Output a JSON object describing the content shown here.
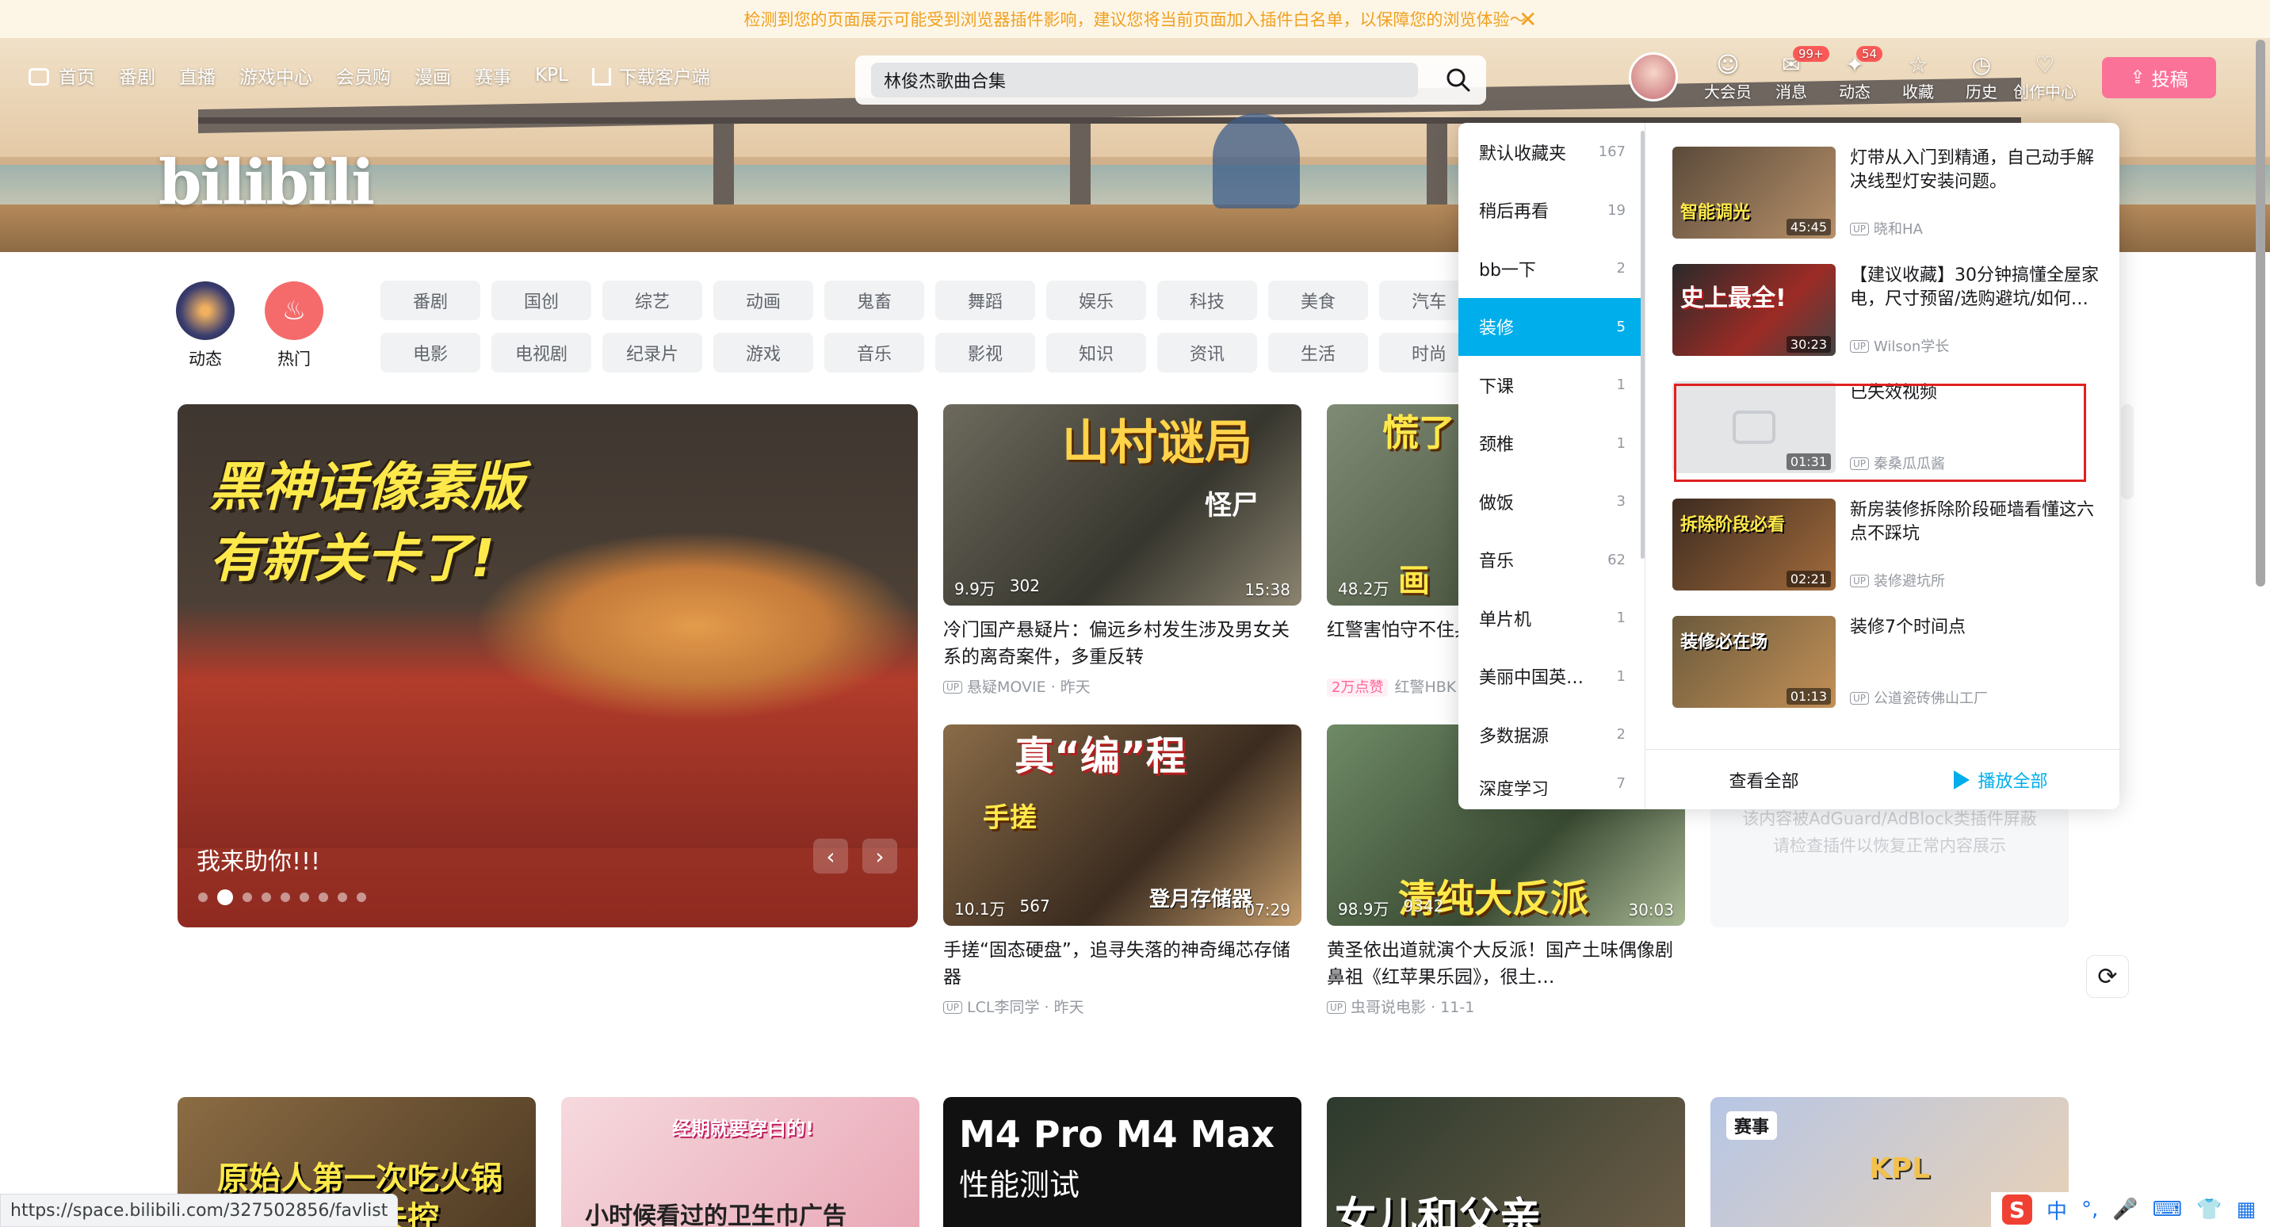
{
  "warning_bar": {
    "text": "检测到您的页面展示可能受到浏览器插件影响，建议您将当前页面加入插件白名单，以保障您的浏览体验～",
    "close_glyph": "✕"
  },
  "nav": {
    "items": [
      "首页",
      "番剧",
      "直播",
      "游戏中心",
      "会员购",
      "漫画",
      "赛事",
      "KPL",
      "下载客户端"
    ]
  },
  "logo_text": "bilibili",
  "search": {
    "value": "林俊杰歌曲合集",
    "icon": "search-icon"
  },
  "header_icons": [
    {
      "label": "大会员",
      "glyph": "☺",
      "badge": ""
    },
    {
      "label": "消息",
      "glyph": "✉",
      "badge": "99+"
    },
    {
      "label": "动态",
      "glyph": "✦",
      "badge": "54"
    },
    {
      "label": "收藏",
      "glyph": "☆",
      "badge": ""
    },
    {
      "label": "历史",
      "glyph": "◷",
      "badge": ""
    },
    {
      "label": "创作中心",
      "glyph": "♡",
      "badge": ""
    }
  ],
  "upload_label": "投稿",
  "quick": [
    {
      "label": "动态"
    },
    {
      "label": "热门",
      "glyph": "♨"
    }
  ],
  "channels": [
    "番剧",
    "国创",
    "综艺",
    "动画",
    "鬼畜",
    "舞蹈",
    "娱乐",
    "科技",
    "美食",
    "汽车",
    "电影",
    "电视剧",
    "纪录片",
    "游戏",
    "音乐",
    "影视",
    "知识",
    "资讯",
    "生活",
    "时尚"
  ],
  "carousel": {
    "art_line1": "黑神话像素版",
    "art_line2": "有新关卡了!",
    "caption": "我来助你!!!",
    "prev": "‹",
    "next": "›"
  },
  "videos": [
    {
      "overlay": "山村谜局",
      "overlay2": "怪尸",
      "plays": "9.9万",
      "danmaku": "302",
      "duration": "15:38",
      "title": "冷门国产悬疑片：偏远乡村发生涉及男女关系的离奇案件，多重反转",
      "up": "悬疑MOVIE",
      "time": "昨天",
      "tag": ""
    },
    {
      "overlay": "慌了",
      "overlay2": "画",
      "plays": "48.2万",
      "danmaku": "",
      "duration": "",
      "title": "红警害怕守不住兵营啊，关起来",
      "up": "红警HBK",
      "time": "",
      "tag": "2万点赞"
    },
    {
      "overlay": "真“编”程",
      "overlay2": "手搓",
      "plays": "10.1万",
      "danmaku": "567",
      "duration": "07:29",
      "title": "手搓“固态硬盘”，追寻失落的神奇绳芯存储器",
      "up": "LCL李同学",
      "time": "昨天",
      "tag": "",
      "corner": "登月存储器"
    },
    {
      "overlay": "清纯大反派",
      "overlay2": "",
      "plays": "98.9万",
      "danmaku": "9342",
      "duration": "30:03",
      "title": "黄圣依出道就演个大反派！国产土味偶像剧鼻祖《红苹果乐园》，很土…",
      "up": "虫哥说电影",
      "time": "11-1",
      "tag": ""
    }
  ],
  "blocked_notice": {
    "line1": "该内容被AdGuard/AdBlock类插件屏蔽",
    "line2": "请检查插件以恢复正常内容展示"
  },
  "bottom_thumbs": [
    {
      "text": "原始人第一次吃火锅",
      "text2": "失控"
    },
    {
      "text": "经期就要穿白的!",
      "text2": "小时候看过的卫生巾广告"
    },
    {
      "text": "M4 Pro  M4 Max",
      "text2": "性能测试"
    },
    {
      "text": "女儿和父亲",
      "text2": ""
    },
    {
      "text": "赛事",
      "text2": "KPL"
    }
  ],
  "favorites": {
    "folders": [
      {
        "name": "默认收藏夹",
        "count": "167"
      },
      {
        "name": "稍后再看",
        "count": "19"
      },
      {
        "name": "bb一下",
        "count": "2"
      },
      {
        "name": "装修",
        "count": "5",
        "active": true
      },
      {
        "name": "下课",
        "count": "1"
      },
      {
        "name": "颈椎",
        "count": "1"
      },
      {
        "name": "做饭",
        "count": "3"
      },
      {
        "name": "音乐",
        "count": "62"
      },
      {
        "name": "单片机",
        "count": "1"
      },
      {
        "name": "美丽中国英…",
        "count": "1"
      },
      {
        "name": "多数据源",
        "count": "2"
      },
      {
        "name": "深度学习",
        "count": "7"
      }
    ],
    "items": [
      {
        "title": "灯带从入门到精通，自己动手解决线型灯安装问题。",
        "up": "晓和HA",
        "duration": "45:45",
        "thumb_text": "智能调光"
      },
      {
        "title": "【建议收藏】30分钟搞懂全屋家电，尺寸预留/选购避坑/如何…",
        "up": "Wilson学长",
        "duration": "30:23",
        "thumb_text": "史上最全!"
      },
      {
        "title": "已失效视频",
        "up": "秦桑瓜瓜酱",
        "duration": "01:31",
        "thumb_text": ""
      },
      {
        "title": "新房装修拆除阶段砸墙看懂这六点不踩坑",
        "up": "装修避坑所",
        "duration": "02:21",
        "thumb_text": "拆除阶段必看"
      },
      {
        "title": "装修7个时间点",
        "up": "公道瓷砖佛山工厂",
        "duration": "01:13",
        "thumb_text": "装修必在场"
      }
    ],
    "view_all": "查看全部",
    "play_all": "播放全部"
  },
  "status_url": "https://space.bilibili.com/327502856/favlist",
  "ime": {
    "logo": "S",
    "lang": "中",
    "punct": "°,"
  }
}
